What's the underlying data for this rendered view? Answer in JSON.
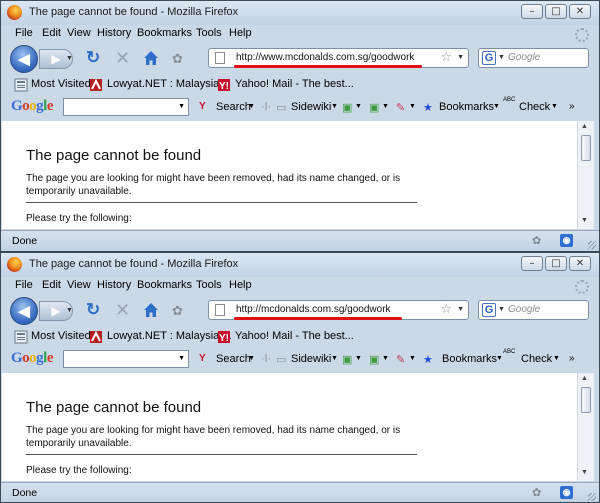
{
  "windows": [
    {
      "title": "The page cannot be found - Mozilla Firefox",
      "window_buttons": [
        "–",
        "□",
        "✕"
      ],
      "menu": [
        {
          "key": "F",
          "rest": "ile"
        },
        {
          "key": "E",
          "rest": "dit"
        },
        {
          "key": "V",
          "rest": "iew"
        },
        {
          "key": "Hi",
          "rest": "story",
          "keyfirst": false,
          "pre": "Hi",
          "ul": "s",
          "post": "tory"
        },
        {
          "key": "B",
          "rest": "ookmarks"
        },
        {
          "key": "T",
          "rest": "ools"
        },
        {
          "key": "H",
          "rest": "elp"
        }
      ],
      "url": "http://www.mcdonalds.com.sg/goodwork",
      "search_placeholder": "Google",
      "bookmarks": [
        "Most Visited",
        "Lowyat.NET : Malaysia...",
        "Yahoo! Mail - The best..."
      ],
      "google_toolbar": {
        "logo": "Google",
        "search_label": "Search",
        "sidewiki_label": "Sidewiki",
        "bookmarks_label": "Bookmarks",
        "check_label": "Check",
        "abc_label": "ABC"
      },
      "page": {
        "heading": "The page cannot be found",
        "paragraph": "The page you are looking for might have been removed, had its name changed, or is temporarily unavailable.",
        "try_text": "Please try the following:"
      },
      "status": "Done"
    },
    {
      "title": "The page cannot be found - Mozilla Firefox",
      "window_buttons": [
        "–",
        "□",
        "✕"
      ],
      "url": "http://mcdonalds.com.sg/goodwork",
      "search_placeholder": "Google",
      "bookmarks": [
        "Most Visited",
        "Lowyat.NET : Malaysia ...",
        "Yahoo! Mail - The best..."
      ],
      "google_toolbar": {
        "logo": "Google",
        "search_label": "Search",
        "sidewiki_label": "Sidewiki",
        "bookmarks_label": "Bookmarks",
        "check_label": "Check",
        "abc_label": "ABC"
      },
      "page": {
        "heading": "The page cannot be found",
        "paragraph": "The page you are looking for might have been removed, had its name changed, or is temporarily unavailable.",
        "try_text": "Please try the following:"
      },
      "status": "Done"
    }
  ],
  "menu_labels": [
    "File",
    "Edit",
    "View",
    "History",
    "Bookmarks",
    "Tools",
    "Help"
  ],
  "colors": {
    "url_underline": "#e01010",
    "titlebar": "#c9d8e8",
    "chrome": "#cbd8e6"
  }
}
